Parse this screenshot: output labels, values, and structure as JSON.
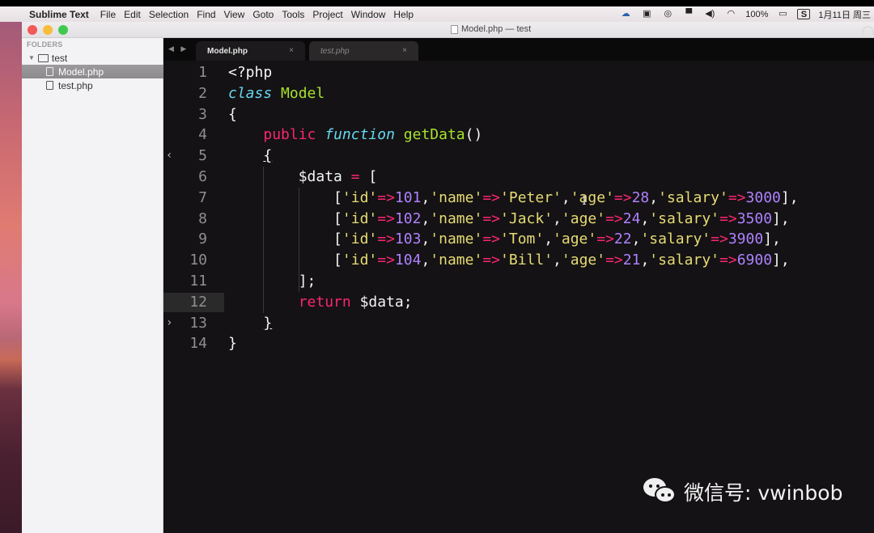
{
  "menubar": {
    "app_name": "Sublime Text",
    "items": [
      "File",
      "Edit",
      "Selection",
      "Find",
      "View",
      "Goto",
      "Tools",
      "Project",
      "Window",
      "Help"
    ],
    "tray": {
      "icons": [
        "cloud-icon",
        "screen-record-icon",
        "sync-icon",
        "display-icon",
        "volume-icon",
        "wifi-icon"
      ],
      "battery_percent": "100%",
      "input_method": "S",
      "date": "1月11日 周三"
    }
  },
  "window": {
    "title": "Model.php — test"
  },
  "sidebar": {
    "header": "FOLDERS",
    "folder": "test",
    "files": [
      {
        "name": "Model.php",
        "selected": true
      },
      {
        "name": "test.php",
        "selected": false
      }
    ]
  },
  "tabs": [
    {
      "label": "Model.php",
      "active": true,
      "close": "×"
    },
    {
      "label": "test.php",
      "active": false,
      "close": "×"
    }
  ],
  "nav_arrows": "◀ ▶",
  "editor": {
    "current_line": 12,
    "lines": [
      {
        "n": "1",
        "tokens": [
          [
            "t-plain",
            "<?php"
          ]
        ]
      },
      {
        "n": "2",
        "tokens": [
          [
            "t-kw",
            "class"
          ],
          [
            "t-plain",
            " "
          ],
          [
            "t-cls",
            "Model"
          ]
        ]
      },
      {
        "n": "3",
        "tokens": [
          [
            "t-plain",
            "{"
          ]
        ]
      },
      {
        "n": "4",
        "tokens": [
          [
            "t-plain",
            "    "
          ],
          [
            "t-st",
            "public"
          ],
          [
            "t-plain",
            " "
          ],
          [
            "t-kw",
            "function"
          ],
          [
            "t-plain",
            " "
          ],
          [
            "t-fn",
            "getData"
          ],
          [
            "t-plain",
            "()"
          ]
        ]
      },
      {
        "n": "5",
        "fold": "‹",
        "tokens": [
          [
            "t-plain",
            "    "
          ],
          [
            "t-plain underline",
            "{"
          ]
        ]
      },
      {
        "n": "6",
        "tokens": [
          [
            "t-plain",
            "        $data "
          ],
          [
            "t-op",
            "="
          ],
          [
            "t-plain",
            " ["
          ]
        ]
      },
      {
        "n": "7",
        "tokens": [
          [
            "t-plain",
            "            ["
          ],
          [
            "t-str",
            "'id'"
          ],
          [
            "t-op",
            "=>"
          ],
          [
            "t-num",
            "101"
          ],
          [
            "t-plain",
            ","
          ],
          [
            "t-str",
            "'name'"
          ],
          [
            "t-op",
            "=>"
          ],
          [
            "t-str",
            "'Peter'"
          ],
          [
            "t-plain",
            ","
          ],
          [
            "t-str",
            "'age'"
          ],
          [
            "t-op",
            "=>"
          ],
          [
            "t-num",
            "28"
          ],
          [
            "t-plain",
            ","
          ],
          [
            "t-str",
            "'salary'"
          ],
          [
            "t-op",
            "=>"
          ],
          [
            "t-num",
            "3000"
          ],
          [
            "t-plain",
            "],"
          ]
        ]
      },
      {
        "n": "8",
        "tokens": [
          [
            "t-plain",
            "            ["
          ],
          [
            "t-str",
            "'id'"
          ],
          [
            "t-op",
            "=>"
          ],
          [
            "t-num",
            "102"
          ],
          [
            "t-plain",
            ","
          ],
          [
            "t-str",
            "'name'"
          ],
          [
            "t-op",
            "=>"
          ],
          [
            "t-str",
            "'Jack'"
          ],
          [
            "t-plain",
            ","
          ],
          [
            "t-str",
            "'age'"
          ],
          [
            "t-op",
            "=>"
          ],
          [
            "t-num",
            "24"
          ],
          [
            "t-plain",
            ","
          ],
          [
            "t-str",
            "'salary'"
          ],
          [
            "t-op",
            "=>"
          ],
          [
            "t-num",
            "3500"
          ],
          [
            "t-plain",
            "],"
          ]
        ]
      },
      {
        "n": "9",
        "tokens": [
          [
            "t-plain",
            "            ["
          ],
          [
            "t-str",
            "'id'"
          ],
          [
            "t-op",
            "=>"
          ],
          [
            "t-num",
            "103"
          ],
          [
            "t-plain",
            ","
          ],
          [
            "t-str",
            "'name'"
          ],
          [
            "t-op",
            "=>"
          ],
          [
            "t-str",
            "'Tom'"
          ],
          [
            "t-plain",
            ","
          ],
          [
            "t-str",
            "'age'"
          ],
          [
            "t-op",
            "=>"
          ],
          [
            "t-num",
            "22"
          ],
          [
            "t-plain",
            ","
          ],
          [
            "t-str",
            "'salary'"
          ],
          [
            "t-op",
            "=>"
          ],
          [
            "t-num",
            "3900"
          ],
          [
            "t-plain",
            "],"
          ]
        ]
      },
      {
        "n": "10",
        "tokens": [
          [
            "t-plain",
            "            ["
          ],
          [
            "t-str",
            "'id'"
          ],
          [
            "t-op",
            "=>"
          ],
          [
            "t-num",
            "104"
          ],
          [
            "t-plain",
            ","
          ],
          [
            "t-str",
            "'name'"
          ],
          [
            "t-op",
            "=>"
          ],
          [
            "t-str",
            "'Bill'"
          ],
          [
            "t-plain",
            ","
          ],
          [
            "t-str",
            "'age'"
          ],
          [
            "t-op",
            "=>"
          ],
          [
            "t-num",
            "21"
          ],
          [
            "t-plain",
            ","
          ],
          [
            "t-str",
            "'salary'"
          ],
          [
            "t-op",
            "=>"
          ],
          [
            "t-num",
            "6900"
          ],
          [
            "t-plain",
            "],"
          ]
        ]
      },
      {
        "n": "11",
        "tokens": [
          [
            "t-plain",
            "        ];"
          ]
        ]
      },
      {
        "n": "12",
        "tokens": [
          [
            "t-plain",
            "        "
          ],
          [
            "t-st",
            "return"
          ],
          [
            "t-plain",
            " $data;"
          ]
        ]
      },
      {
        "n": "13",
        "fold": "›",
        "tokens": [
          [
            "t-plain",
            "    "
          ],
          [
            "t-plain underline",
            "}"
          ]
        ]
      },
      {
        "n": "14",
        "tokens": [
          [
            "t-plain",
            "}"
          ]
        ]
      }
    ]
  },
  "watermark": {
    "text": "微信号: vwinbob"
  },
  "colors": {
    "keyword": "#66d9ef",
    "storage": "#f92672",
    "function": "#a6e22e",
    "string": "#e6db74",
    "number": "#ae81ff",
    "background": "#141214"
  }
}
